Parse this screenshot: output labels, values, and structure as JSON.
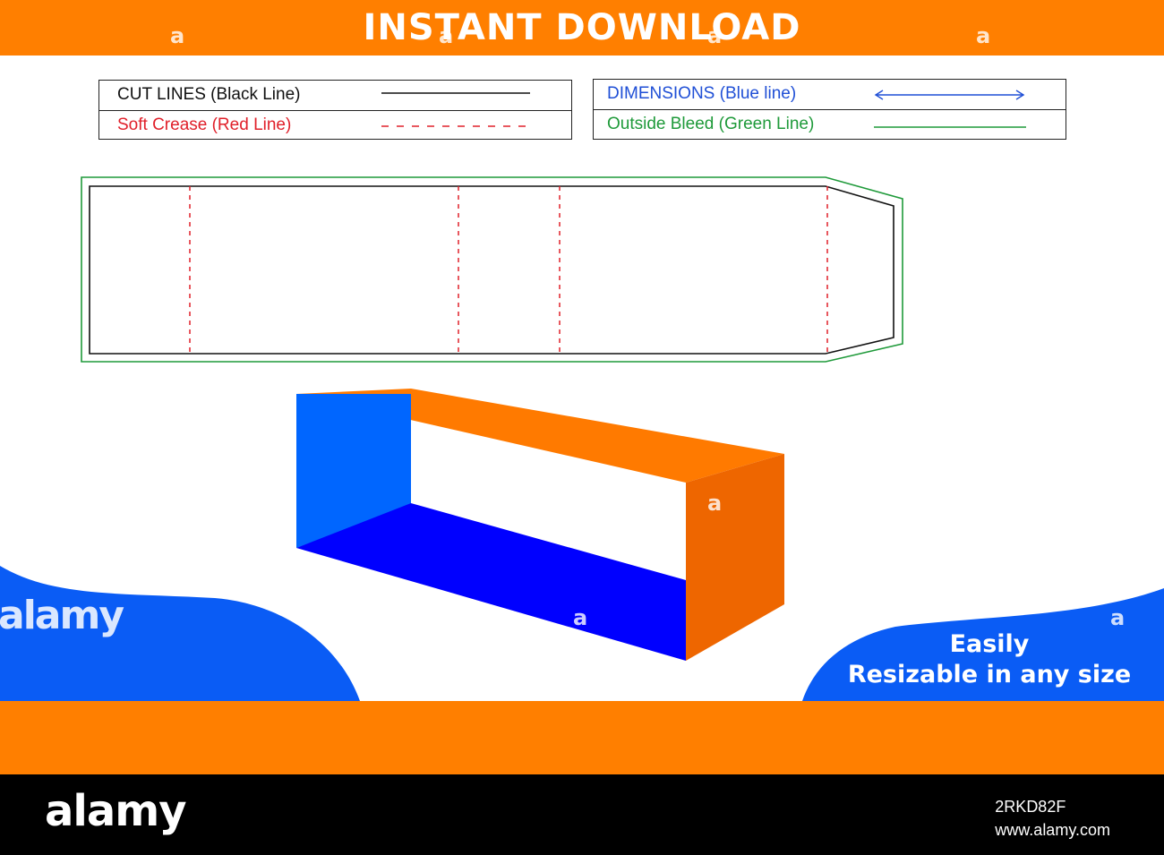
{
  "header": {
    "title": "INSTANT DOWNLOAD"
  },
  "legend": {
    "cut_lines": "CUT LINES (Black Line)",
    "soft_crease": "Soft Crease (Red Line)",
    "dimensions": "DIMENSIONS (Blue line)",
    "outside_bleed": "Outside Bleed (Green Line)"
  },
  "promo": {
    "line1": "Easily",
    "line2": "Resizable in any size"
  },
  "watermark": {
    "word": "alamy",
    "mark": "a"
  },
  "footer": {
    "logo": "alamy",
    "image_id": "2RKD82F",
    "site": "www.alamy.com"
  },
  "colors": {
    "orange": "#ff7f00",
    "blue": "#0a5cf5",
    "cut": "#111111",
    "crease": "#e0202a",
    "dimension": "#1f4fd6",
    "bleed": "#1f9a3a",
    "box_blue_side": "#0066ff",
    "box_blue_bottom": "#0000ff",
    "box_orange_top": "#ff7a00",
    "box_orange_side": "#ee6600"
  }
}
